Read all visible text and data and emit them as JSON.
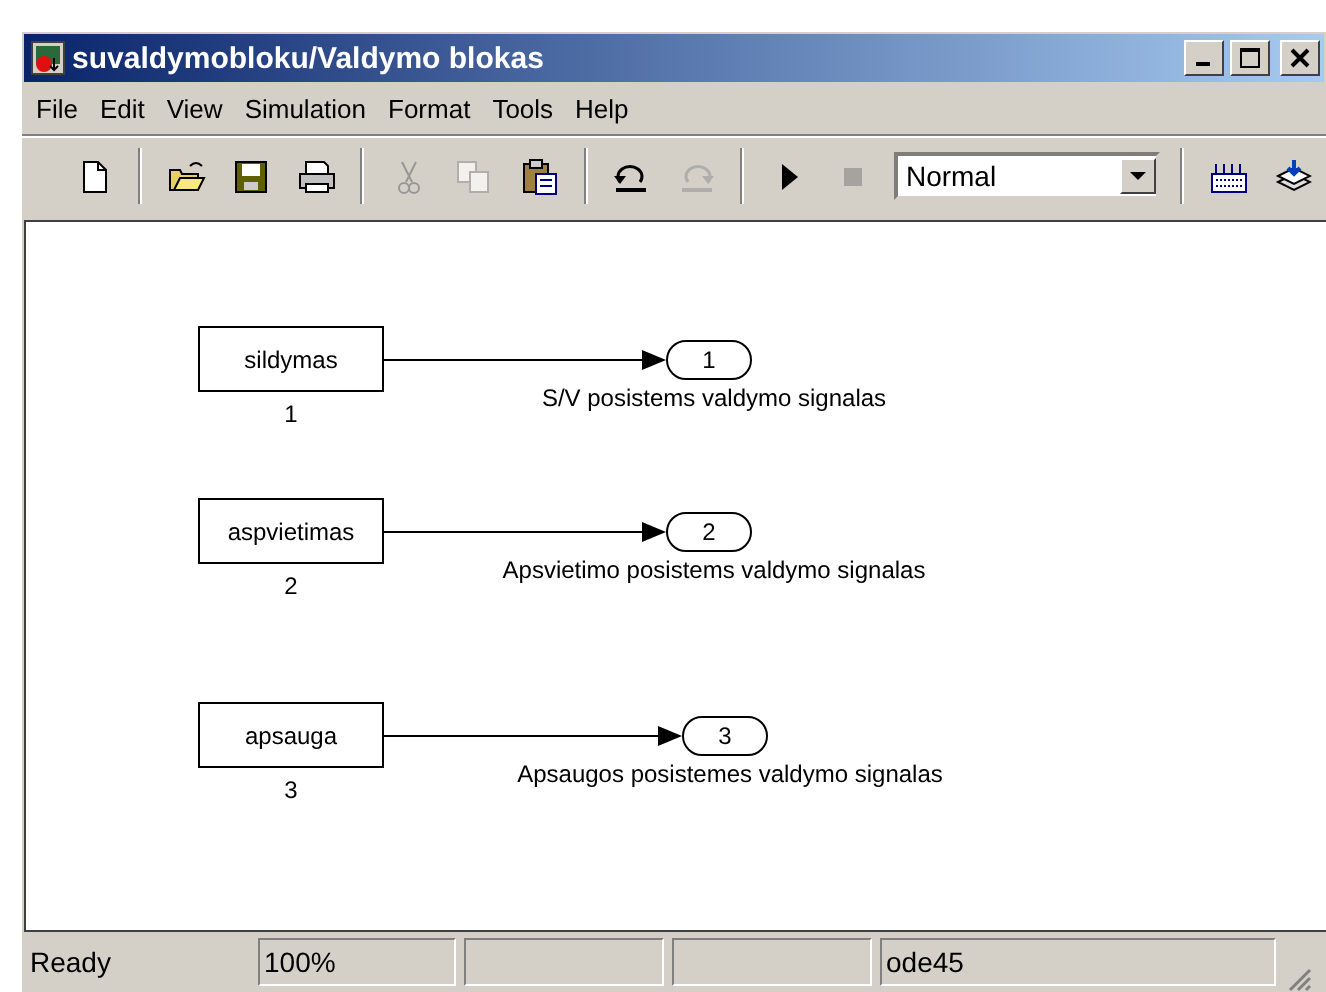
{
  "window": {
    "title": "suvaldymobloku/Valdymo blokas"
  },
  "menu": [
    "File",
    "Edit",
    "View",
    "Simulation",
    "Format",
    "Tools",
    "Help"
  ],
  "toolbar": {
    "groups": [
      [
        {
          "kind": "new",
          "disabled": false
        }
      ],
      [
        {
          "kind": "open",
          "disabled": false
        },
        {
          "kind": "save",
          "disabled": false
        },
        {
          "kind": "print",
          "disabled": false
        }
      ],
      [
        {
          "kind": "cut",
          "disabled": true
        },
        {
          "kind": "copy",
          "disabled": true
        },
        {
          "kind": "paste",
          "disabled": false
        }
      ],
      [
        {
          "kind": "undo",
          "disabled": false
        },
        {
          "kind": "redo",
          "disabled": true
        }
      ],
      [
        {
          "kind": "start",
          "disabled": false
        },
        {
          "kind": "stop",
          "disabled": true
        }
      ]
    ],
    "mode": {
      "value": "Normal"
    },
    "tail": [
      {
        "kind": "library",
        "disabled": false
      },
      {
        "kind": "explorer",
        "disabled": false
      }
    ]
  },
  "diagram": {
    "blocks": [
      {
        "name": "sildymas",
        "number": "1",
        "port": "1",
        "signal": "S/V posistems valdymo signalas"
      },
      {
        "name": "aspvietimas",
        "number": "2",
        "port": "2",
        "signal": "Apsvietimo posistems valdymo signalas"
      },
      {
        "name": "apsauga",
        "number": "3",
        "port": "3",
        "signal": "Apsaugos posistemes valdymo signalas"
      }
    ]
  },
  "status_bar": {
    "message": "Ready",
    "zoom": "100%",
    "solver": "ode45"
  }
}
